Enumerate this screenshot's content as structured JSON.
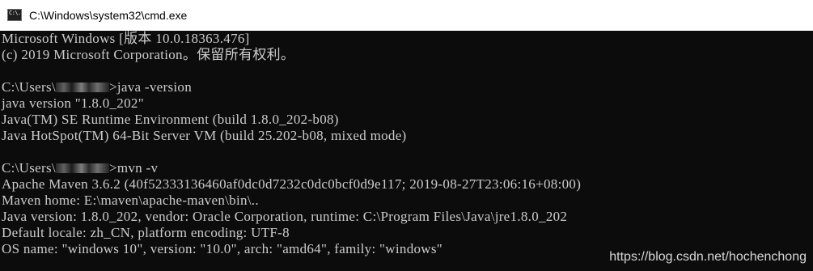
{
  "window": {
    "title": "C:\\Windows\\system32\\cmd.exe",
    "icon_name": "cmd-console-icon",
    "icon_text": "C:\\."
  },
  "console": {
    "lines": [
      "Microsoft Windows [版本 10.0.18363.476]",
      "(c) 2019 Microsoft Corporation。保留所有权利。",
      "",
      "",
      "java -version",
      "java version \"1.8.0_202\"",
      "Java(TM) SE Runtime Environment (build 1.8.0_202-b08)",
      "Java HotSpot(TM) 64-Bit Server VM (build 25.202-b08, mixed mode)",
      "",
      "",
      "mvn -v",
      "Apache Maven 3.6.2 (40f52333136460af0dc0d7232c0dc0bcf0d9e117; 2019-08-27T23:06:16+08:00)",
      "Maven home: E:\\maven\\apache-maven\\bin\\..",
      "Java version: 1.8.0_202, vendor: Oracle Corporation, runtime: C:\\Program Files\\Java\\jre1.8.0_202",
      "Default locale: zh_CN, platform encoding: UTF-8",
      "OS name: \"windows 10\", version: \"10.0\", arch: \"amd64\", family: \"windows\""
    ],
    "prompt_prefix": "C:\\Users\\",
    "prompt_suffix": ">"
  },
  "watermark": "https://blog.csdn.net/hochenchong",
  "colors": {
    "console_bg": "#0c0c0c",
    "console_text": "#cccccc",
    "titlebar_bg": "#ffffff"
  }
}
